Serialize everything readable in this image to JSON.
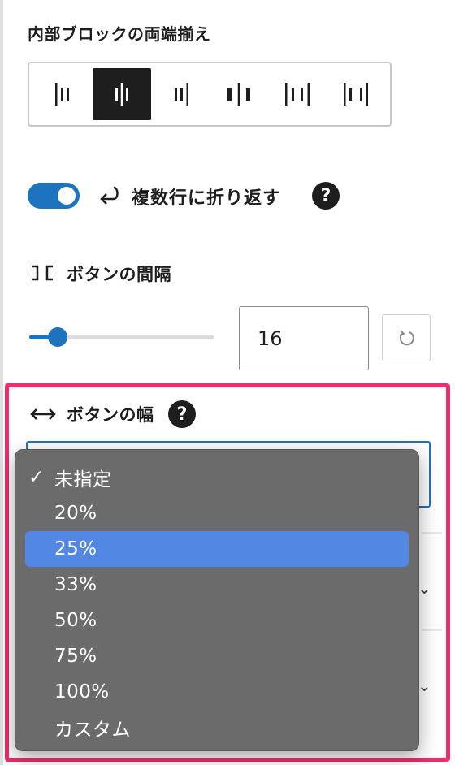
{
  "justification": {
    "title": "内部ブロックの両端揃え",
    "options": [
      {
        "icon": "justify-left-icon",
        "active": false
      },
      {
        "icon": "justify-center-icon",
        "active": true
      },
      {
        "icon": "justify-right-icon",
        "active": false
      },
      {
        "icon": "justify-space-between-icon",
        "active": false
      },
      {
        "icon": "justify-stretch-icon",
        "active": false
      },
      {
        "icon": "justify-space-around-icon",
        "active": false
      }
    ]
  },
  "wrap": {
    "label": "複数行に折り返す",
    "enabled": true,
    "help": "?"
  },
  "gap": {
    "label": "ボタンの間隔",
    "value": "16",
    "slider_fraction": 0.16
  },
  "width": {
    "label": "ボタンの幅",
    "help": "?"
  },
  "dropdown": {
    "options": [
      "未指定",
      "20%",
      "25%",
      "33%",
      "50%",
      "75%",
      "100%",
      "カスタム"
    ],
    "checked": "未指定",
    "highlighted": "25%",
    "check_mark": "✓"
  },
  "colors": {
    "accent": "#1e73be",
    "highlight_border": "#ec2f6c",
    "menu_bg": "#6b6b6b",
    "menu_selected": "#5288e3"
  }
}
